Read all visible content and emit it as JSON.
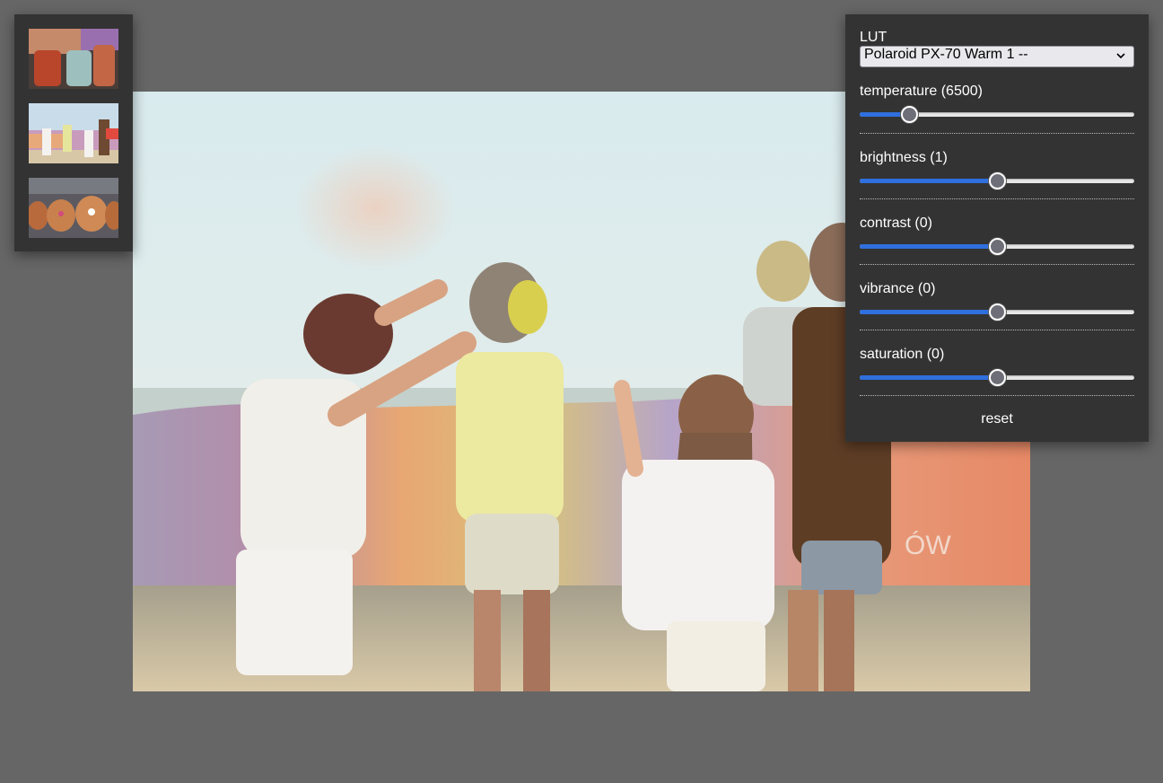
{
  "thumbnails": [
    {
      "name": "bags",
      "alt": "thumbnail-bags"
    },
    {
      "name": "holi-festival",
      "alt": "thumbnail-holi"
    },
    {
      "name": "pumpkins",
      "alt": "thumbnail-pumpkins"
    }
  ],
  "controls": {
    "lut_label": "LUT",
    "lut_selected": "Polaroid PX-70 Warm 1 --",
    "sliders": [
      {
        "key": "temperature",
        "label": "temperature (6500)",
        "value": 0.18
      },
      {
        "key": "brightness",
        "label": "brightness (1)",
        "value": 0.5
      },
      {
        "key": "contrast",
        "label": "contrast (0)",
        "value": 0.5
      },
      {
        "key": "vibrance",
        "label": "vibrance (0)",
        "value": 0.5
      },
      {
        "key": "saturation",
        "label": "saturation (0)",
        "value": 0.5
      }
    ],
    "reset_label": "reset"
  },
  "colors": {
    "background": "#666666",
    "panel": "#333333",
    "slider_fill": "#2f6fde",
    "slider_track": "#e6e6e6"
  }
}
